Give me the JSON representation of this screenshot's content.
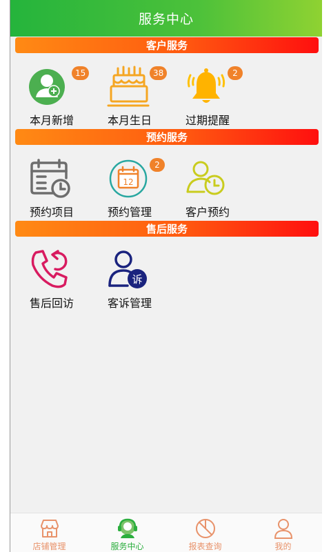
{
  "header": {
    "title": "服务中心"
  },
  "sections": [
    {
      "title": "客户服务",
      "items": [
        {
          "label": "本月新增",
          "badge": "15",
          "icon": "add-user-icon"
        },
        {
          "label": "本月生日",
          "badge": "38",
          "icon": "birthday-cake-icon"
        },
        {
          "label": "过期提醒",
          "badge": "2",
          "icon": "bell-icon"
        }
      ]
    },
    {
      "title": "预约服务",
      "items": [
        {
          "label": "预约项目",
          "icon": "calendar-clock-icon"
        },
        {
          "label": "预约管理",
          "badge": "2",
          "icon": "calendar-12-icon",
          "icon_text": "12"
        },
        {
          "label": "客户预约",
          "icon": "user-clock-icon"
        }
      ]
    },
    {
      "title": "售后服务",
      "items": [
        {
          "label": "售后回访",
          "icon": "phone-callback-icon"
        },
        {
          "label": "客诉管理",
          "icon": "complaint-user-icon",
          "icon_text": "诉"
        }
      ]
    }
  ],
  "tabbar": {
    "active": 1,
    "items": [
      {
        "label": "店铺管理",
        "icon": "store-icon"
      },
      {
        "label": "服务中心",
        "icon": "service-headset-icon"
      },
      {
        "label": "报表查询",
        "icon": "report-chart-icon"
      },
      {
        "label": "我的",
        "icon": "profile-icon"
      }
    ]
  },
  "colors": {
    "header_green": "#25b43c",
    "section_orange": "#ff8a14",
    "section_red": "#ff0f0f",
    "badge": "#f0822a",
    "active_tab": "#2bae3e",
    "inactive_tab": "#e8926a"
  }
}
